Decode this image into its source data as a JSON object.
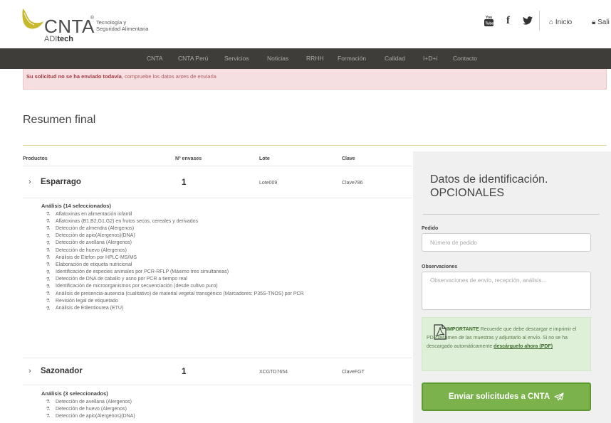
{
  "brand": {
    "name": "CNTA",
    "reg": "®",
    "tagline_line1": "Tecnología y",
    "tagline_line2": "Seguridad Alimentaria",
    "sub_prefix": "ADI",
    "sub_suffix": "tech",
    "colors": {
      "leaf": "#c6b92b",
      "nav_bg": "#3e3d39",
      "button": "#7bb24b"
    }
  },
  "header": {
    "social_icons": [
      "youtube-icon",
      "facebook-icon",
      "twitter-icon"
    ],
    "youtube_label": "You Tube",
    "facebook_label": "f",
    "twitter_label": "🐦",
    "home_label": "Inicio",
    "logout_label": "Sali"
  },
  "nav": {
    "items": [
      "CNTA",
      "CNTA Perú",
      "Servicios",
      "Noticias",
      "RRHH",
      "Formación",
      "Calidad",
      "I+D+i",
      "Contacto"
    ]
  },
  "alert": {
    "strong": "Su solicitud no se ha enviado todavía",
    "rest": ", compruebe los datos antes de enviarla"
  },
  "page": {
    "title": "Resumen final"
  },
  "table": {
    "headers": {
      "productos": "Productos",
      "envases": "Nº envases",
      "lote": "Lote",
      "clave": "Clave"
    },
    "products": [
      {
        "name": "Esparrago",
        "qty": "1",
        "lote": "Lote009",
        "clave": "Clave786",
        "analysis_title": "Análisis (14 seleccionados)",
        "analyses": [
          "Aflatoxinas en alimentación infantil",
          "Aflatoxinas (B1,B2,G1,G2) en frutos secos, cereales y derivados",
          "Detección de almendra (Alergenos)",
          "Detección de apio(Alergenos)(DNA)",
          "Detección de avellana (Alergenos)",
          "Detección de huevo (Alergenos)",
          "Análisis de Etefon por HPLC-MS/MS",
          "Elaboración de etiqueta nutricional",
          "Identificación de especies animales por PCR-RFLP (Máximo tres simultaneas)",
          "Detección de DNA de caballo y asno por PCR a tiempo real",
          "Identificación de microorganismos por secuenciación (desde cultivo puro)",
          "Análisis de presencia-ausencia (cualitativo) de material vegetal transgénico (Marcadores: P35S-TNOS) por PCR",
          "Revisión legal de etiquetado",
          "Análisis de Etilentiourea (ETU)"
        ]
      },
      {
        "name": "Sazonador",
        "qty": "1",
        "lote": "XCGTD7654",
        "clave": "ClaveFGT",
        "analysis_title": "Análisis (3 seleccionados)",
        "analyses": [
          "Detección de avellana (Alergenos)",
          "Detección de huevo (Alergenos)",
          "Detección de apio(Alergenos)(DNA)"
        ]
      }
    ]
  },
  "panel": {
    "title_line1": "Datos de identificación.",
    "title_line2": "OPCIONALES",
    "pedido_label": "Pedido",
    "pedido_placeholder": "Número de pedido",
    "obs_label": "Observaciones",
    "obs_placeholder": "Observaciones de envío, recepción, análisis...",
    "notice_strong": "IMPORTANTE",
    "notice_text": " Recuerde que debe descargar e imprimir el PDF resumen de las muestras y adjuntarlo al envío. Si no se ha descargado automáticamente ",
    "notice_link": "descárguelo ahora (PDF)",
    "send_label": "Enviar solicitudes a CNTA"
  }
}
